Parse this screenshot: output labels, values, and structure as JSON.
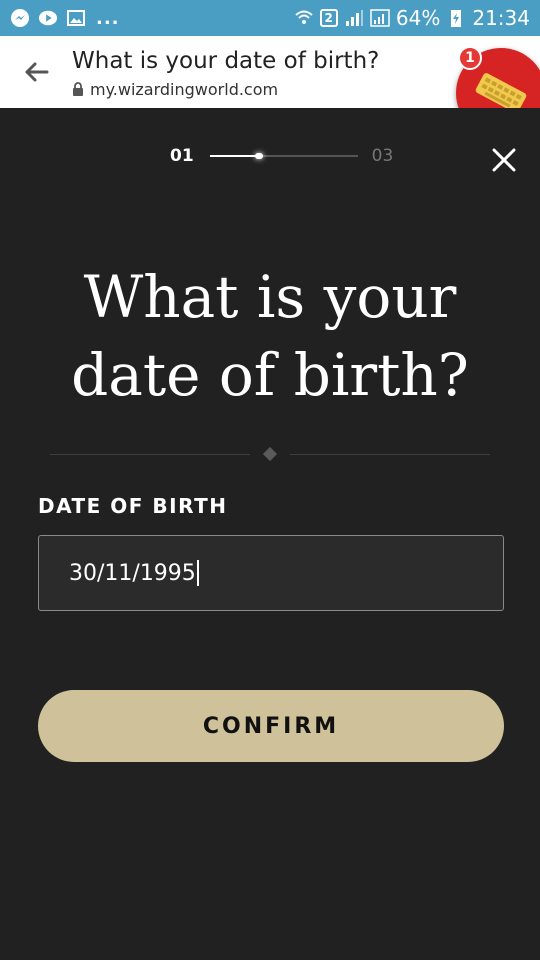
{
  "status_bar": {
    "dots": "...",
    "sim": "2",
    "battery": "64%",
    "time": "21:34",
    "color": "#4a9ec4",
    "left_icons": [
      "messenger-icon",
      "video-icon",
      "image-icon"
    ],
    "right_icons": [
      "wifi-icon",
      "signal-icon",
      "signal-icon",
      "charging-icon"
    ]
  },
  "browser": {
    "page_title": "What is your date of birth?",
    "url": "my.wizardingworld.com",
    "badge_count": "1"
  },
  "progress": {
    "current_step": "01",
    "total_steps": "03",
    "fraction": 0.33
  },
  "form": {
    "heading": "What is your date of birth?",
    "field_label": "DATE OF BIRTH",
    "dob_value": "30/11/1995",
    "confirm_label": "CONFIRM"
  },
  "colors": {
    "background": "#212121",
    "button": "#cfc29b",
    "badge": "#d62424"
  }
}
